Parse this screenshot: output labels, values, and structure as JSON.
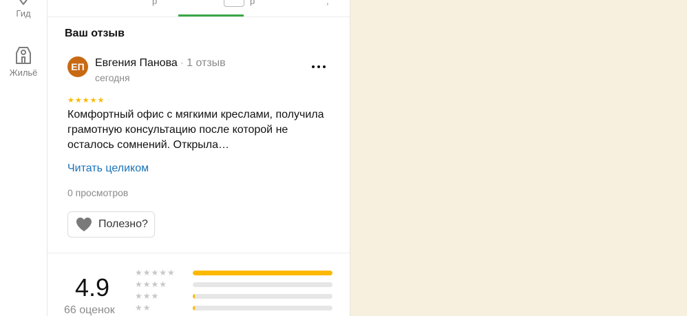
{
  "sidebar": {
    "items": [
      {
        "label": "Гид",
        "icon": "guide-icon"
      },
      {
        "label": "Жильё",
        "icon": "housing-icon"
      }
    ]
  },
  "review": {
    "section_title": "Ваш отзыв",
    "author": {
      "initials": "ЕП",
      "name": "Евгения Панова",
      "separator": "·",
      "reviews_count": "1 отзыв",
      "avatar_color": "#c86a13"
    },
    "date": "сегодня",
    "stars": "★★★★★",
    "rating": 5,
    "text": "Комфортный офис с мягкими креслами, получила грамотную консультацию после которой не осталось сомнений. Открыла…",
    "read_more": "Читать целиком",
    "views": "0 просмотров",
    "useful_label": "Полезно?"
  },
  "summary": {
    "rating": "4.9",
    "count_label": "66 оценок",
    "distribution": [
      {
        "stars": "★★★★★",
        "fraction": 1.0
      },
      {
        "stars": "★★★★",
        "fraction": 0.0
      },
      {
        "stars": "★★★",
        "fraction": 0.015
      },
      {
        "stars": "★★",
        "fraction": 0.015
      }
    ]
  },
  "colors": {
    "accent": "#3aa645",
    "link": "#1a73b8",
    "star": "#fcb900",
    "map_background": "#f7f0de"
  }
}
